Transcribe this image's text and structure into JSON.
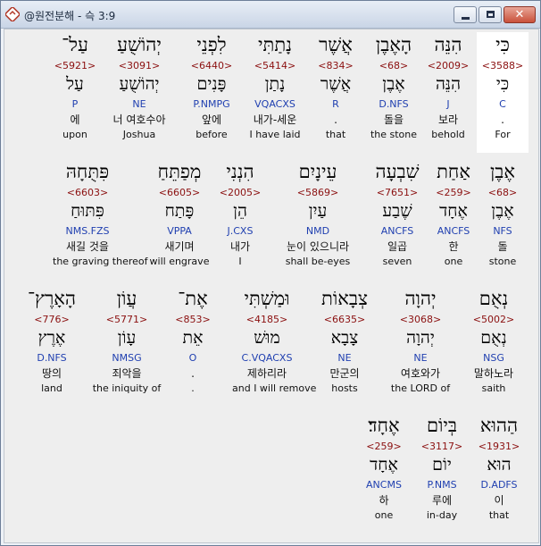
{
  "window": {
    "title": "@원전분해 - 슥 3:9",
    "colors": {
      "strongs": "#8b1010",
      "morph": "#1f3fb0",
      "highlight": "#ffffff"
    }
  },
  "controls": {
    "minimize": "minimize-icon",
    "maximize": "maximize-icon",
    "close": "✕"
  },
  "rows": [
    [
      {
        "heb": "כִּי",
        "num": "<3588>",
        "heb2": "כִּי",
        "code": "C",
        "kor": ".",
        "eng": "For"
      },
      {
        "heb": "הִנֵּה",
        "num": "<2009>",
        "heb2": "הִנֵּה",
        "code": "J",
        "kor": "보라",
        "eng": "behold"
      },
      {
        "heb": "הָאֶבֶן",
        "num": "<68>",
        "heb2": "אֶבֶן",
        "code": "D.NFS",
        "kor": "돌을",
        "eng": "the stone"
      },
      {
        "heb": "אֲשֶׁר",
        "num": "<834>",
        "heb2": "אֲשֶׁר",
        "code": "R",
        "kor": ".",
        "eng": "that"
      },
      {
        "heb": "נָתַתִּי",
        "num": "<5414>",
        "heb2": "נָתַן",
        "code": "VQACXS",
        "kor": "내가-세운",
        "eng": "I have laid"
      },
      {
        "heb": "לִפְנֵי",
        "num": "<6440>",
        "heb2": "פָּנִים",
        "code": "P.NMPG",
        "kor": "앞에",
        "eng": "before"
      },
      {
        "heb": "יְהוֹשֻׁעַ",
        "num": "<3091>",
        "heb2": "יְהוֹשֻׁעַ",
        "code": "NE",
        "kor": "너 여호수아",
        "eng": "Joshua"
      },
      {
        "heb": "עַל־",
        "num": "<5921>",
        "heb2": "עַל",
        "code": "P",
        "kor": "에",
        "eng": "upon"
      }
    ],
    [
      {
        "heb": "אֶבֶן",
        "num": "<68>",
        "heb2": "אֶבֶן",
        "code": "NFS",
        "kor": "돌",
        "eng": "stone"
      },
      {
        "heb": "אַחַת",
        "num": "<259>",
        "heb2": "אֶחָד",
        "code": "ANCFS",
        "kor": "한",
        "eng": "one"
      },
      {
        "heb": "שִׁבְעָה",
        "num": "<7651>",
        "heb2": "שֶׁבַע",
        "code": "ANCFS",
        "kor": "일곱",
        "eng": "seven"
      },
      {
        "heb": "עֵינָיִם",
        "num": "<5869>",
        "heb2": "עַיִן",
        "code": "NMD",
        "kor": "눈이 있으니라",
        "eng": "shall be-eyes"
      },
      {
        "heb": "הִנְנִי",
        "num": "<2005>",
        "heb2": "הֵן",
        "code": "J.CXS",
        "kor": "내가",
        "eng": "I"
      },
      {
        "heb": "מְפַתֵּחַ",
        "num": "<6605>",
        "heb2": "פָּתַח",
        "code": "VPPA",
        "kor": "새기며",
        "eng": "will engrave"
      },
      {
        "heb": "פִּתֻּחָהּ",
        "num": "<6603>",
        "heb2": "פִּתּוּחַ",
        "code": "NMS.FZS",
        "kor": "새길 것을",
        "eng": "the graving thereof"
      }
    ],
    [
      {
        "heb": "נְאֻם",
        "num": "<5002>",
        "heb2": "נְאֻם",
        "code": "NSG",
        "kor": "말하노라",
        "eng": "saith"
      },
      {
        "heb": "יְהוָה",
        "num": "<3068>",
        "heb2": "יְהוָה",
        "code": "NE",
        "kor": "여호와가",
        "eng": "the LORD of"
      },
      {
        "heb": "צְבָאוֹת",
        "num": "<6635>",
        "heb2": "צָבָא",
        "code": "NE",
        "kor": "만군의",
        "eng": "hosts"
      },
      {
        "heb": "וּמַשְׁתִּי",
        "num": "<4185>",
        "heb2": "מוּשׁ",
        "code": "C.VQACXS",
        "kor": "제하리라",
        "eng": "and I will remove"
      },
      {
        "heb": "אֶת־",
        "num": "<853>",
        "heb2": "אֵת",
        "code": "O",
        "kor": ".",
        "eng": "."
      },
      {
        "heb": "עֲוֹן",
        "num": "<5771>",
        "heb2": "עָוֹן",
        "code": "NMSG",
        "kor": "죄악을",
        "eng": "the iniquity of"
      },
      {
        "heb": "הָאָרֶץ־",
        "num": "<776>",
        "heb2": "אֶרֶץ",
        "code": "D.NFS",
        "kor": "땅의",
        "eng": "land"
      }
    ],
    [
      {
        "heb": "הַהוּא",
        "num": "<1931>",
        "heb2": "הוּא",
        "code": "D.ADFS",
        "kor": "이",
        "eng": "that"
      },
      {
        "heb": "בְּיוֹם",
        "num": "<3117>",
        "heb2": "יוֹם",
        "code": "P.NMS",
        "kor": "루에",
        "eng": "in-day"
      },
      {
        "heb": "אֶחָד׃",
        "num": "<259>",
        "heb2": "אֶחָד",
        "code": "ANCMS",
        "kor": "하",
        "eng": "one"
      }
    ]
  ]
}
